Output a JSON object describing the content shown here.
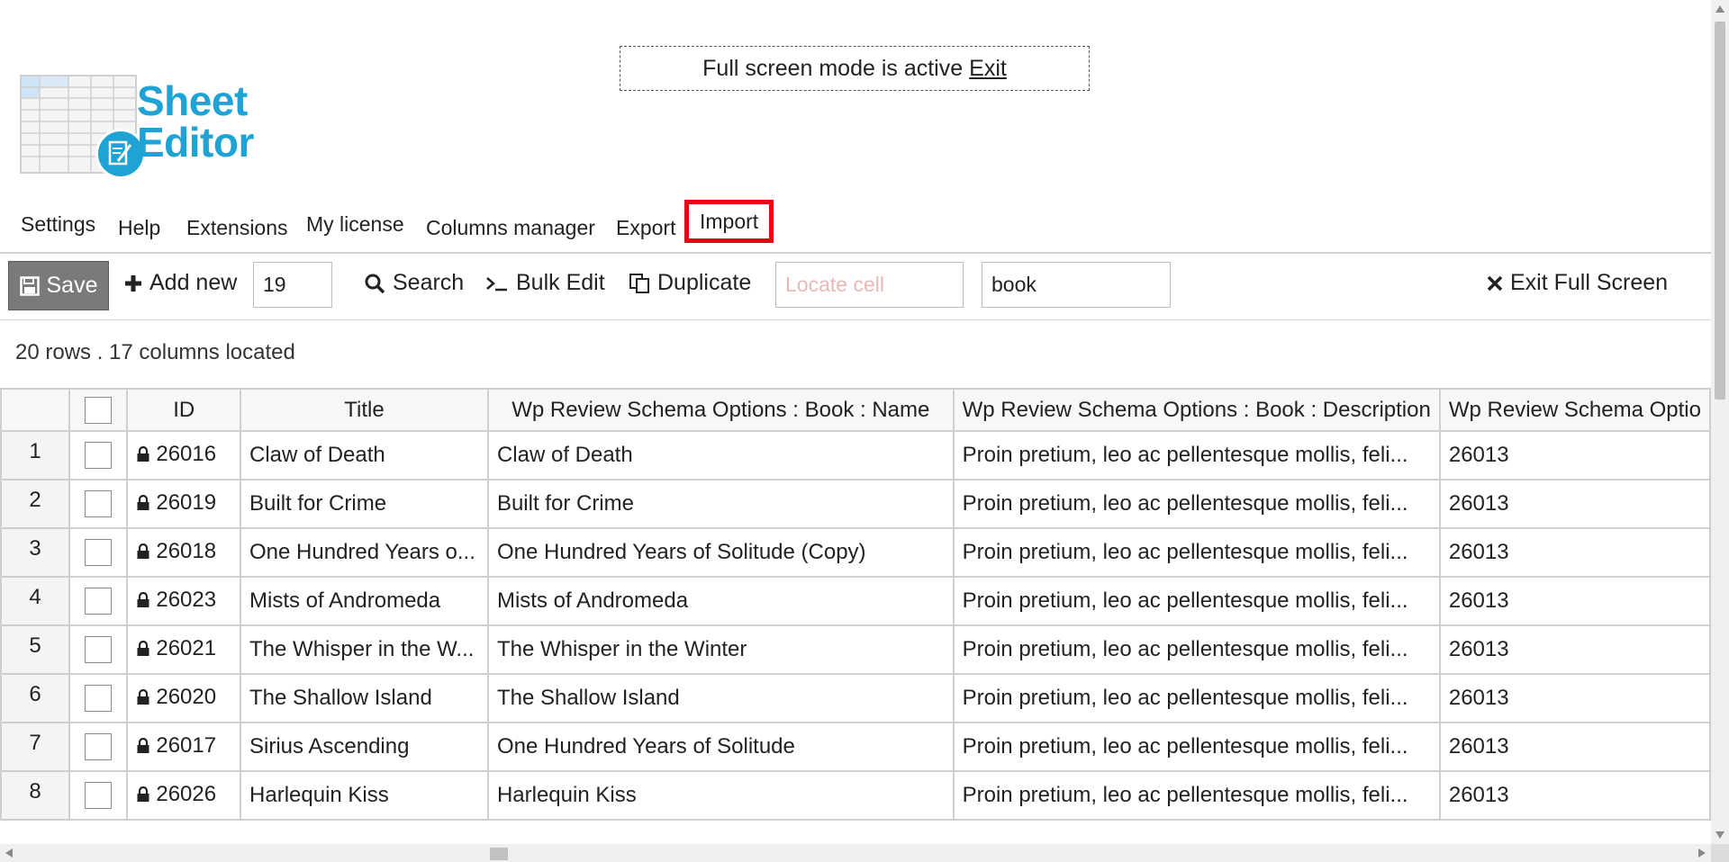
{
  "banner": {
    "text": "Full screen mode is active",
    "exit_link": "Exit"
  },
  "logo": {
    "line1": "Sheet",
    "line2": "Editor",
    "icon": "spreadsheet-pencil-icon"
  },
  "nav": {
    "settings": "Settings",
    "help": "Help",
    "extensions": "Extensions",
    "my_license": "My license",
    "columns_manager": "Columns manager",
    "export": "Export",
    "import": "Import"
  },
  "toolbar": {
    "save": "Save",
    "add_new": "Add new",
    "add_count": "19",
    "search": "Search",
    "bulk_edit": "Bulk Edit",
    "duplicate": "Duplicate",
    "locate_placeholder": "Locate cell",
    "filter_value": "book",
    "exit_full_screen": "Exit Full Screen"
  },
  "status": {
    "rows_info": "20 rows . 17 columns located"
  },
  "table": {
    "headers": {
      "id": "ID",
      "title": "Title",
      "name": "Wp Review Schema Options : Book : Name",
      "description": "Wp Review Schema Options : Book : Description",
      "extra": "Wp Review Schema Optio"
    },
    "rows": [
      {
        "num": "1",
        "id": "26016",
        "title": "Claw of Death",
        "name": "Claw of Death",
        "description": "Proin pretium, leo ac pellentesque mollis, feli...",
        "extra": "26013"
      },
      {
        "num": "2",
        "id": "26019",
        "title": "Built for Crime",
        "name": "Built for Crime",
        "description": "Proin pretium, leo ac pellentesque mollis, feli...",
        "extra": "26013"
      },
      {
        "num": "3",
        "id": "26018",
        "title": "One Hundred Years o...",
        "name": "One Hundred Years of Solitude (Copy)",
        "description": "Proin pretium, leo ac pellentesque mollis, feli...",
        "extra": "26013"
      },
      {
        "num": "4",
        "id": "26023",
        "title": "Mists of Andromeda",
        "name": "Mists of Andromeda",
        "description": "Proin pretium, leo ac pellentesque mollis, feli...",
        "extra": "26013"
      },
      {
        "num": "5",
        "id": "26021",
        "title": "The Whisper in the W...",
        "name": "The Whisper in the Winter",
        "description": "Proin pretium, leo ac pellentesque mollis, feli...",
        "extra": "26013"
      },
      {
        "num": "6",
        "id": "26020",
        "title": "The Shallow Island",
        "name": "The Shallow Island",
        "description": "Proin pretium, leo ac pellentesque mollis, feli...",
        "extra": "26013"
      },
      {
        "num": "7",
        "id": "26017",
        "title": "Sirius Ascending",
        "name": "One Hundred Years of Solitude",
        "description": "Proin pretium, leo ac pellentesque mollis, feli...",
        "extra": "26013"
      },
      {
        "num": "8",
        "id": "26026",
        "title": "Harlequin Kiss",
        "name": "Harlequin Kiss",
        "description": "Proin pretium, leo ac pellentesque mollis, feli...",
        "extra": "26013"
      }
    ]
  },
  "colors": {
    "brand": "#1fa3d4",
    "highlight": "#e30613",
    "save_bg": "#7a7a7a"
  }
}
